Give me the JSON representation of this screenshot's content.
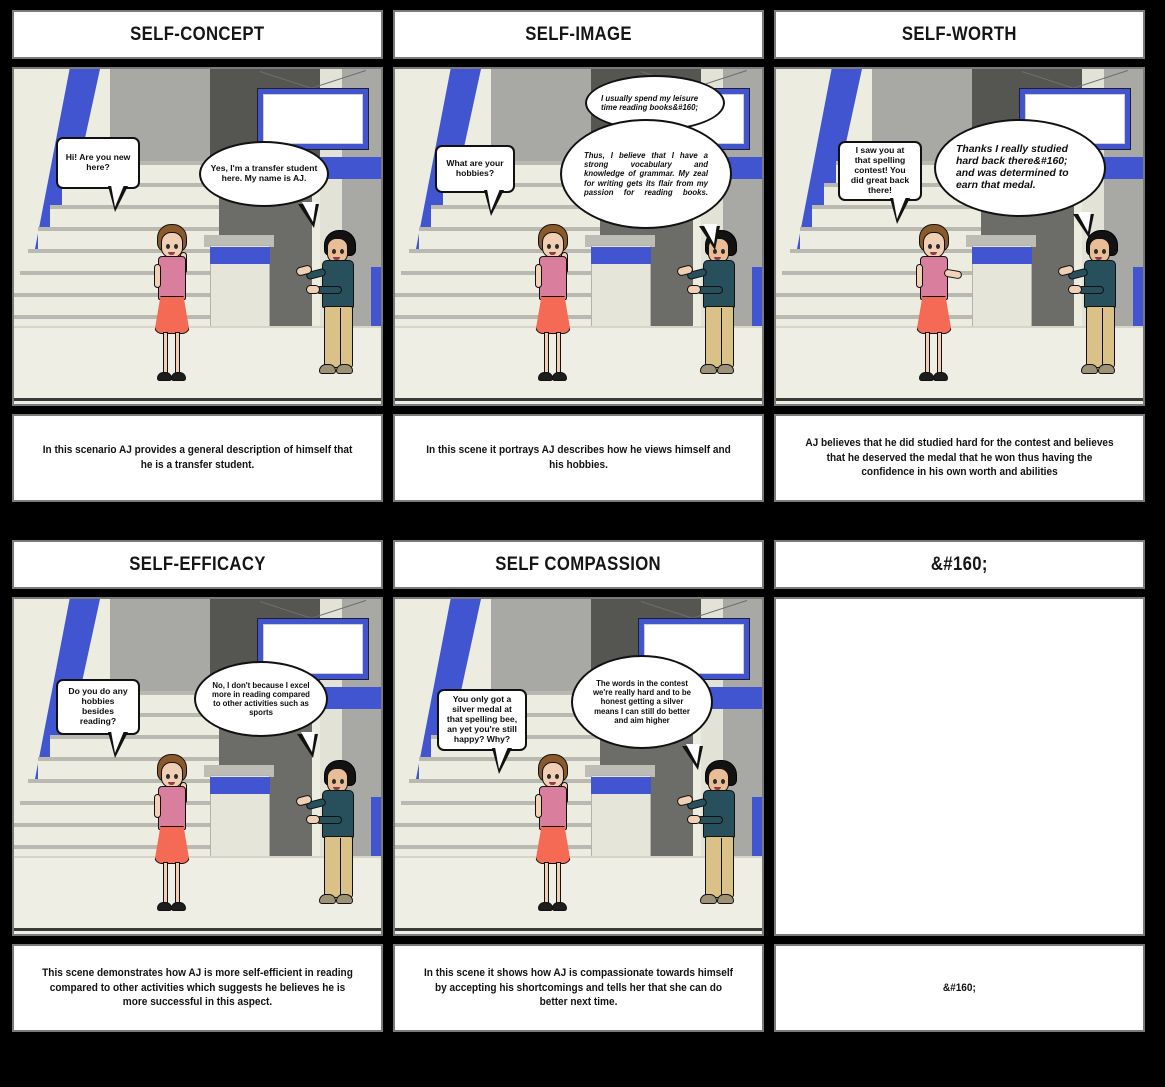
{
  "board": {
    "background_color": "#000000",
    "cell_border_color": "#7a7a7a",
    "accent_blue": "#4055cf"
  },
  "panels": [
    {
      "id": "self-concept",
      "title": "SELF-CONCEPT",
      "bubbles": [
        {
          "speaker": "girl",
          "text": "Hi! Are you new here?",
          "shape": "rect",
          "style": "normal"
        },
        {
          "speaker": "boy",
          "text": "Yes, I'm a transfer student here. My name is AJ.",
          "shape": "oval",
          "style": "normal"
        }
      ],
      "caption": "In this scenario AJ provides a general description of himself that he is a transfer student."
    },
    {
      "id": "self-image",
      "title": "SELF-IMAGE",
      "bubbles": [
        {
          "speaker": "boy",
          "text": "I usually spend my leisure time reading books&#160;",
          "shape": "oval",
          "style": "italic"
        },
        {
          "speaker": "girl",
          "text": "What are your hobbies?",
          "shape": "rect",
          "style": "normal"
        },
        {
          "speaker": "boy",
          "text": "Thus, I believe that I have a strong vocabulary and knowledge of grammar. My zeal for writing gets its flair from my passion for reading books.",
          "shape": "oval",
          "style": "italic"
        }
      ],
      "caption": "In this scene it portrays AJ describes how he views himself and his hobbies."
    },
    {
      "id": "self-worth",
      "title": "SELF-WORTH",
      "bubbles": [
        {
          "speaker": "girl",
          "text": "I saw you at that spelling contest! You did great back there!",
          "shape": "rect",
          "style": "normal"
        },
        {
          "speaker": "boy",
          "text": "Thanks I really studied hard back there&#160; and was determined to earn that medal.",
          "shape": "oval",
          "style": "italic"
        }
      ],
      "caption": "AJ believes that he did studied hard for the contest and believes that he deserved the medal that he won thus having the confidence in his own worth and abilities"
    },
    {
      "id": "self-efficacy",
      "title": "SELF-EFFICACY",
      "bubbles": [
        {
          "speaker": "girl",
          "text": "Do you do any hobbies besides reading?",
          "shape": "rect",
          "style": "normal"
        },
        {
          "speaker": "boy",
          "text": "No, I don't because I excel more in reading compared to other activities such as sports",
          "shape": "oval",
          "style": "normal"
        }
      ],
      "caption": "This scene demonstrates how AJ is more self-efficient in reading compared to other activities which suggests he believes he is more successful in this aspect."
    },
    {
      "id": "self-compassion",
      "title": "SELF COMPASSION",
      "bubbles": [
        {
          "speaker": "girl",
          "text": "You only got a silver medal at that spelling bee, an yet you're still happy? Why?",
          "shape": "rect",
          "style": "normal"
        },
        {
          "speaker": "boy",
          "text": "The words in the contest we're really hard and to be honest getting a silver means I can still do better and aim higher",
          "shape": "oval",
          "style": "normal"
        }
      ],
      "caption": "In this scene it shows how AJ is compassionate towards himself by accepting his shortcomings and tells her that she can do better next time."
    },
    {
      "id": "blank",
      "title": "&#160;",
      "bubbles": [],
      "caption": "&#160;"
    }
  ]
}
